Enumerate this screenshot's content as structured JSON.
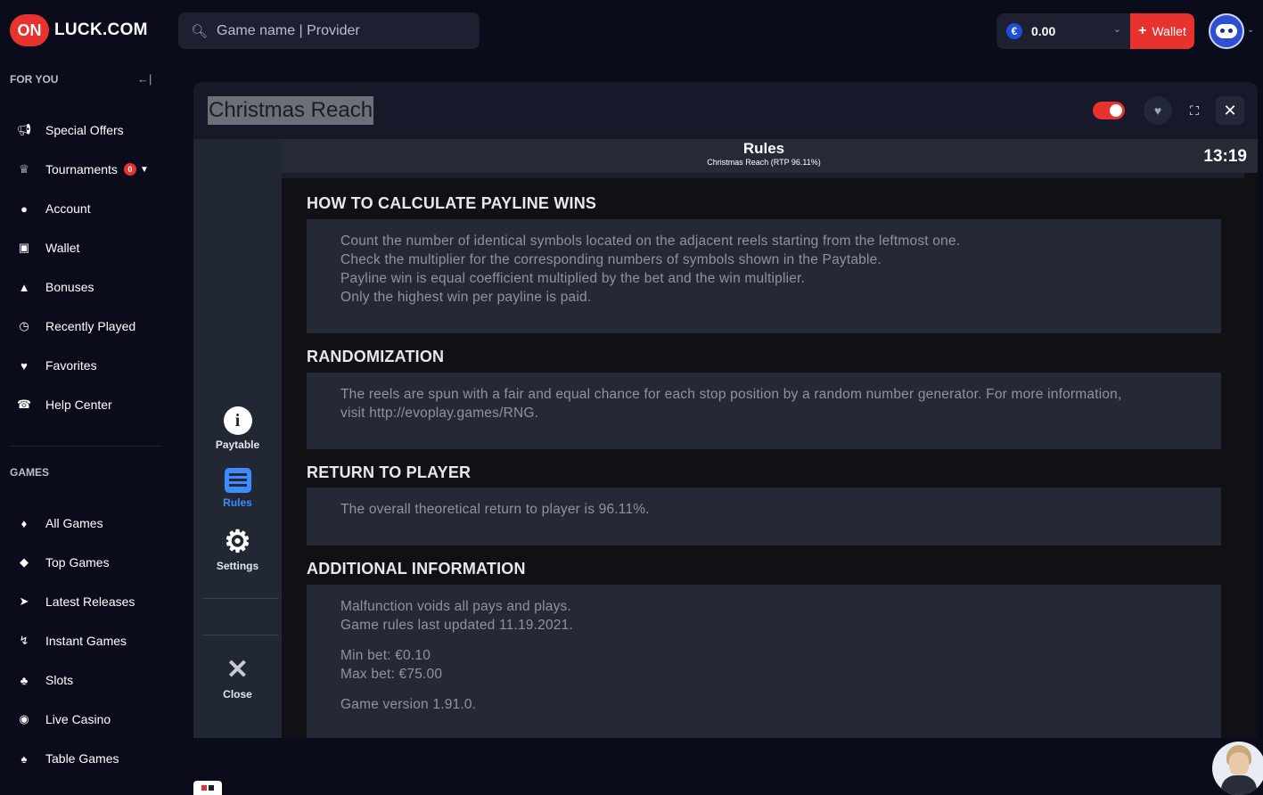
{
  "brand": {
    "badge": "ON",
    "name": "LUCK.COM"
  },
  "search": {
    "placeholder": "Game name | Provider"
  },
  "account": {
    "currency_symbol": "€",
    "balance": "0.00",
    "wallet_label": "Wallet"
  },
  "sidebar": {
    "for_you_title": "FOR YOU",
    "for_you": [
      {
        "label": "Special Offers",
        "icon": "megaphone-icon"
      },
      {
        "label": "Tournaments",
        "icon": "trophy-icon",
        "badge": "0"
      },
      {
        "label": "Account",
        "icon": "user-icon"
      },
      {
        "label": "Wallet",
        "icon": "wallet-icon"
      },
      {
        "label": "Bonuses",
        "icon": "bag-icon"
      },
      {
        "label": "Recently Played",
        "icon": "clock-icon"
      },
      {
        "label": "Favorites",
        "icon": "heart-bookmark-icon"
      },
      {
        "label": "Help Center",
        "icon": "headset-icon"
      }
    ],
    "games_title": "GAMES",
    "games": [
      {
        "label": "All Games",
        "icon": "cards-icon"
      },
      {
        "label": "Top Games",
        "icon": "diamond-icon"
      },
      {
        "label": "Latest Releases",
        "icon": "rocket-icon"
      },
      {
        "label": "Instant Games",
        "icon": "lightning-icon"
      },
      {
        "label": "Slots",
        "icon": "cherry-icon"
      },
      {
        "label": "Live Casino",
        "icon": "chip-icon"
      },
      {
        "label": "Table Games",
        "icon": "card-icon"
      }
    ]
  },
  "game": {
    "title": "Christmas Reach",
    "menu": {
      "paytable": "Paytable",
      "rules": "Rules",
      "settings": "Settings",
      "close": "Close"
    },
    "rules_header": {
      "title": "Rules",
      "subtitle": "Christmas Reach (RTP 96.11%)",
      "clock": "13:19"
    },
    "sections": [
      {
        "title": "HOW TO CALCULATE PAYLINE WINS",
        "lines": [
          "Count the number of identical symbols located on the adjacent reels starting from the leftmost one.",
          "Check the multiplier for the corresponding numbers of symbols shown in the Paytable.",
          "Payline win is equal coefficient multiplied by the bet and the win multiplier.",
          "Only the highest win per payline is paid."
        ]
      },
      {
        "title": "RANDOMIZATION",
        "lines": [
          "The reels are spun with a fair and equal chance for each stop position by a random number generator. For more information,",
          "visit http://evoplay.games/RNG."
        ]
      },
      {
        "title": "RETURN TO PLAYER",
        "lines": [
          "The overall theoretical return to player is 96.11%."
        ]
      },
      {
        "title": "ADDITIONAL INFORMATION",
        "lines": [
          "Malfunction voids all pays and plays.",
          "Game rules last updated 11.19.2021.",
          "Min bet: €0.10",
          "Max bet: €75.00",
          "Game version 1.91.0."
        ]
      }
    ]
  },
  "colors": {
    "accent_red": "#e8322d",
    "accent_blue": "#3d8bff",
    "background": "#0a0c1c"
  }
}
